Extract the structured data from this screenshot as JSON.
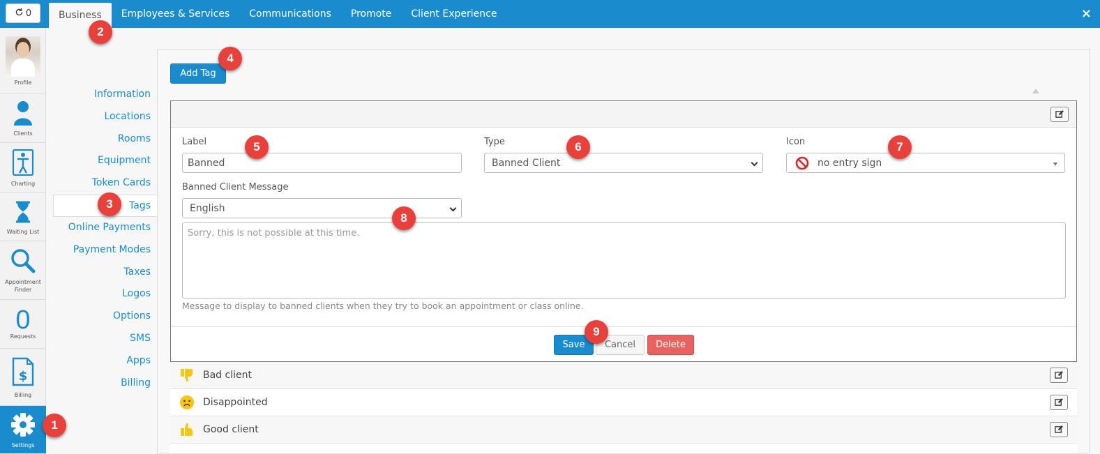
{
  "topbar": {
    "refresh_count": "0",
    "tabs": [
      {
        "label": "Business",
        "active": true
      },
      {
        "label": "Employees & Services"
      },
      {
        "label": "Communications"
      },
      {
        "label": "Promote"
      },
      {
        "label": "Client Experience"
      }
    ],
    "close": "×"
  },
  "rail": {
    "items": [
      {
        "label": "Profile",
        "icon": "avatar"
      },
      {
        "label": "Clients",
        "icon": "person-icon"
      },
      {
        "label": "Charting",
        "icon": "body-chart-icon"
      },
      {
        "label": "Waiting List",
        "icon": "hourglass-icon"
      },
      {
        "label": "Appointment Finder",
        "icon": "magnifier-icon"
      },
      {
        "label": "Requests",
        "value": "0"
      },
      {
        "label": "Billing",
        "icon": "invoice-dollar-icon"
      },
      {
        "label": "Settings",
        "icon": "gear-icon",
        "active": true
      }
    ]
  },
  "subnav": {
    "items": [
      "Information",
      "Locations",
      "Rooms",
      "Equipment",
      "Token Cards",
      "Tags",
      "Online Payments",
      "Payment Modes",
      "Taxes",
      "Logos",
      "Options",
      "SMS",
      "Apps",
      "Billing"
    ],
    "active": "Tags"
  },
  "main": {
    "add_tag_label": "Add Tag",
    "editor": {
      "label_caption": "Label",
      "label_value": "Banned",
      "type_caption": "Type",
      "type_value": "Banned Client",
      "icon_caption": "Icon",
      "icon_value": "no entry sign",
      "icon_name": "no-entry-sign-icon",
      "message_caption": "Banned Client Message",
      "language_value": "English",
      "message_placeholder": "Sorry, this is not possible at this time.",
      "help_text": "Message to display to banned clients when they try to book an appointment or class online.",
      "save_label": "Save",
      "cancel_label": "Cancel",
      "delete_label": "Delete"
    },
    "tags": [
      {
        "name": "Bad client",
        "icon": "thumbs-down-icon"
      },
      {
        "name": "Disappointed",
        "icon": "frowning-face-icon"
      },
      {
        "name": "Good client",
        "icon": "thumbs-up-icon"
      }
    ]
  },
  "callouts": [
    "1",
    "2",
    "3",
    "4",
    "5",
    "6",
    "7",
    "8",
    "9"
  ],
  "colors": {
    "accent": "#1a8bcd",
    "badge": "#e8403b",
    "delete": "#e8635f",
    "emoji": "#f5c518"
  }
}
